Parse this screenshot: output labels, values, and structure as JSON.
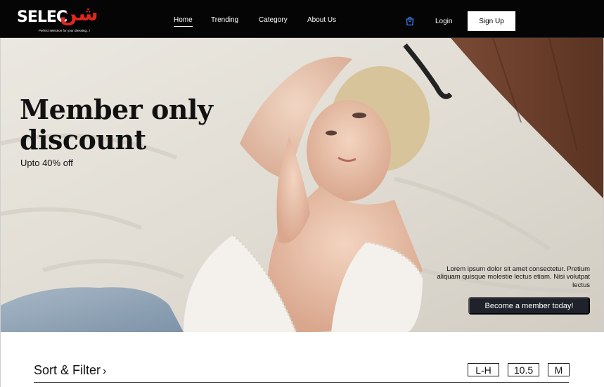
{
  "brand": {
    "word": "SELEC",
    "arabic": "شن",
    "tagline": "Perfect selection for your dressing...!"
  },
  "nav": {
    "links": [
      {
        "label": "Home",
        "active": true
      },
      {
        "label": "Trending",
        "active": false
      },
      {
        "label": "Category",
        "active": false
      },
      {
        "label": "About Us",
        "active": false
      }
    ],
    "cart_icon": "shopping-bag-icon",
    "login_label": "Login",
    "signup_label": "Sign Up"
  },
  "hero": {
    "title_line1": "Member only",
    "title_line2": "discount",
    "subtitle": "Upto 40% off",
    "description": "Lorem ipsum dolor sit amet consectetur. Pretium aliquam quisque molestie lectus etiam. Nisi volutpat lectus",
    "cta_label": "Become a member today!"
  },
  "filters": {
    "label": "Sort & Filter",
    "chevron": "›",
    "chips": [
      "L-H",
      "10.5",
      "M"
    ]
  },
  "colors": {
    "nav_bg": "#050505",
    "brand_red": "#e0261d",
    "cart_blue": "#3b82f6",
    "cta_bg": "#1f222b"
  }
}
